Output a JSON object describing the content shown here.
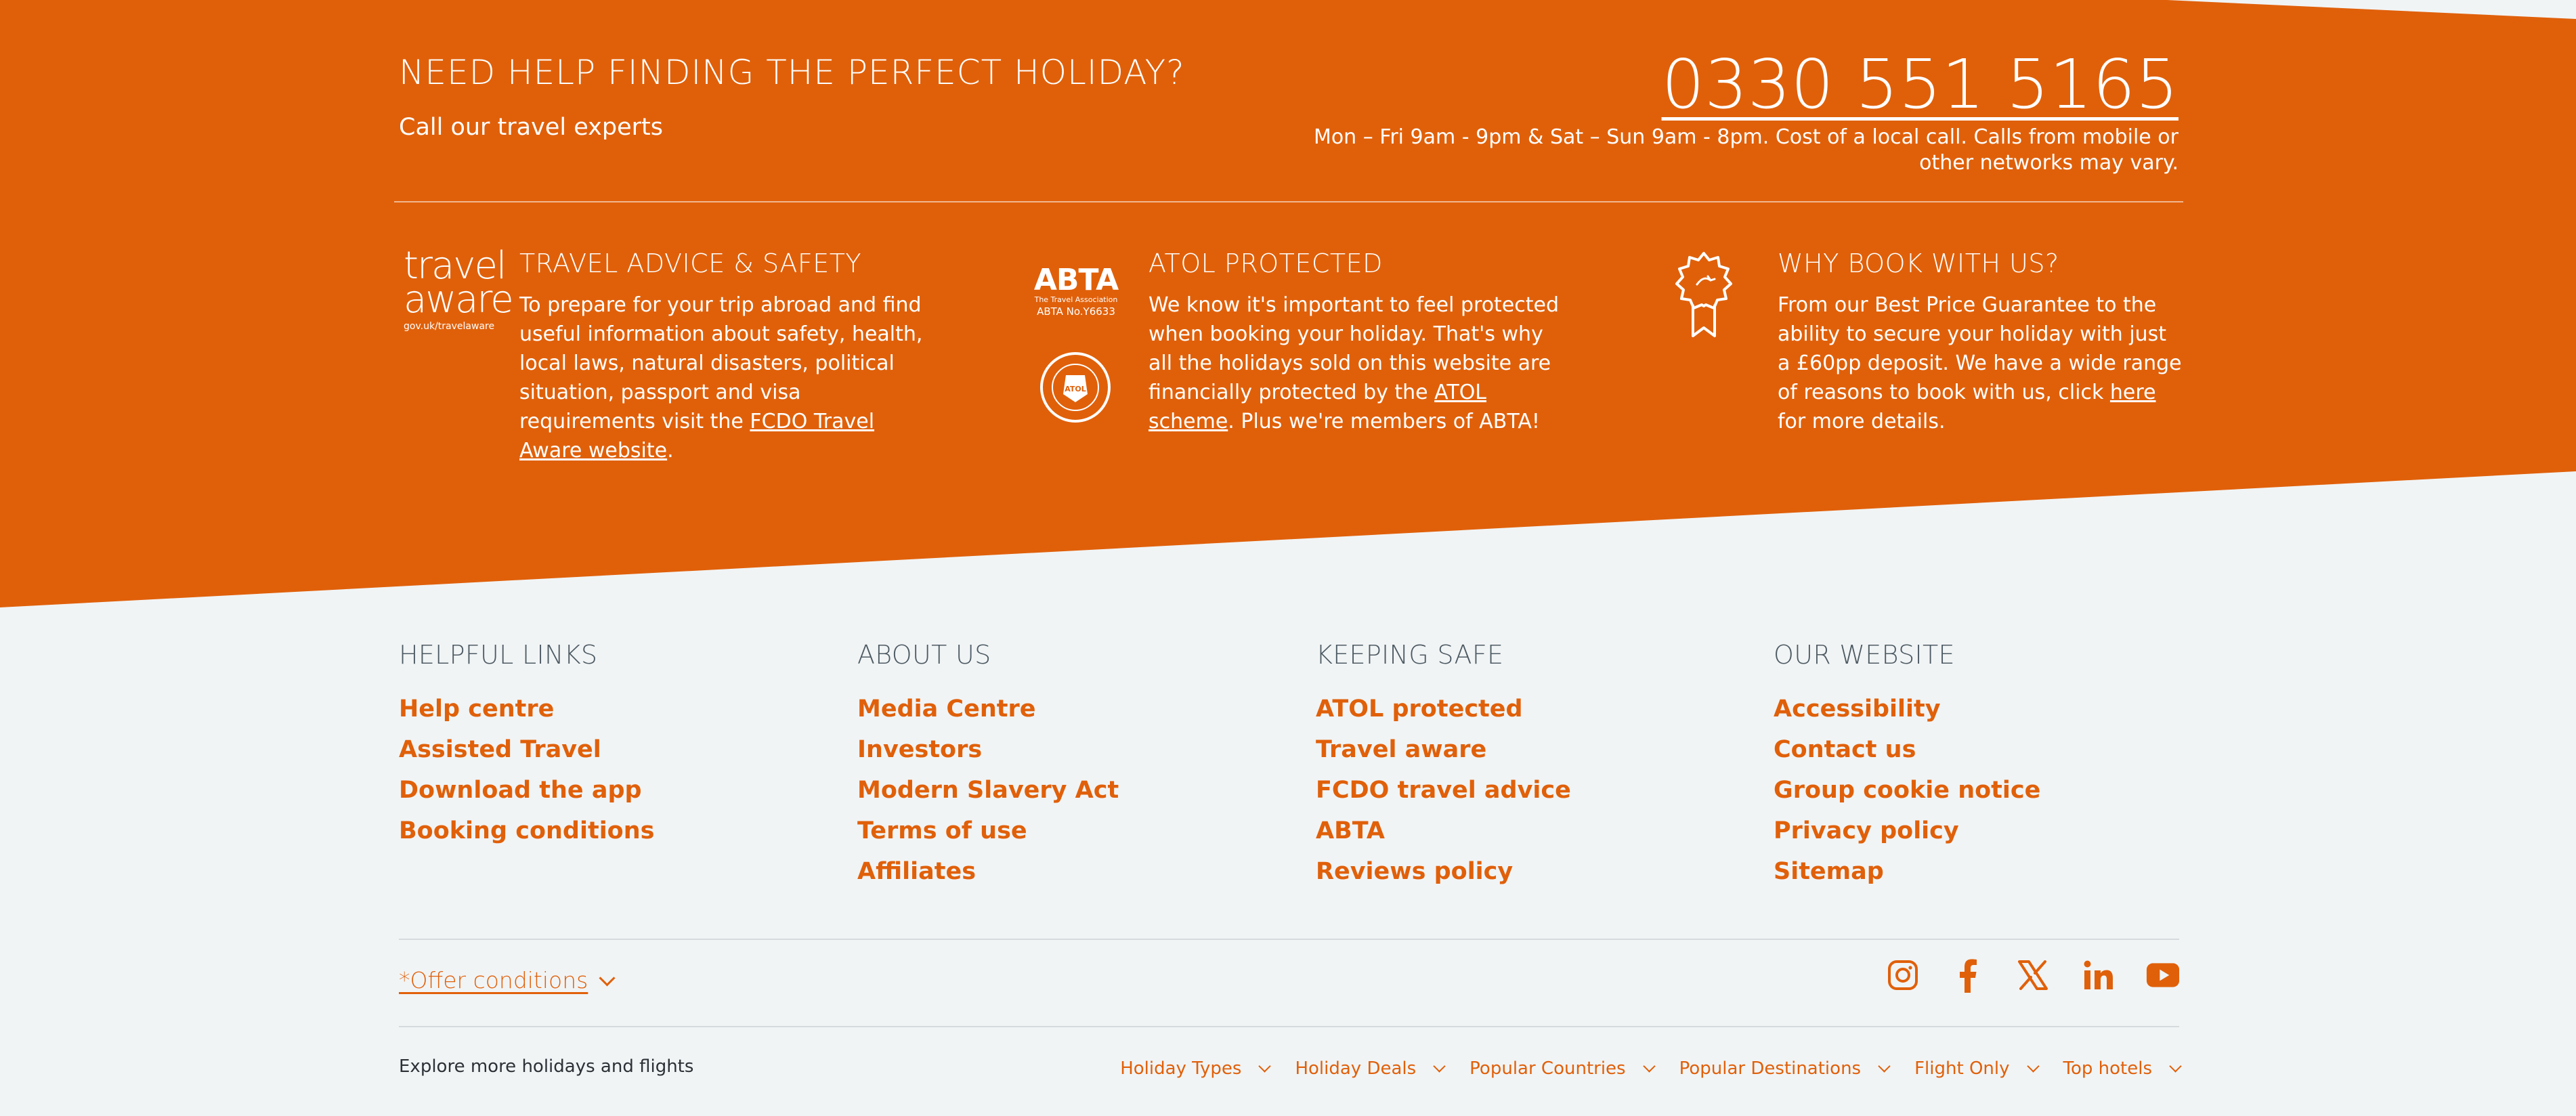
{
  "colors": {
    "brand_orange": "#e0600a",
    "background": "#f1f4f5",
    "heading_grey": "#4d5a63"
  },
  "help": {
    "title": "NEED HELP FINDING THE PERFECT HOLIDAY?",
    "subtitle": "Call our travel experts",
    "phone": "0330 551 5165",
    "hours": "Mon – Fri 9am - 9pm & Sat – Sun 9am - 8pm. Cost of a local call. Calls from mobile or other networks may vary."
  },
  "features": {
    "travel_advice": {
      "logo_word1": "travel",
      "logo_word2": "aware",
      "logo_url": "gov.uk/travelaware",
      "title": "TRAVEL ADVICE & SAFETY",
      "body_before": "To prepare for your trip abroad and find useful information about safety, health, local laws, natural disasters, political situation, passport and visa requirements visit the ",
      "link": "FCDO Travel Aware website",
      "body_after": "."
    },
    "atol": {
      "abta_logo": "ABTA",
      "abta_small": "The Travel Association",
      "abta_number": "ABTA No.Y6633",
      "title": "ATOL PROTECTED",
      "body_before": "We know it's important to feel protected when booking your holiday. That's why all the holidays sold on this website are financially protected by the ",
      "link": "ATOL scheme",
      "body_after": ". Plus we're members of ABTA!"
    },
    "why_book": {
      "title": "WHY BOOK WITH US?",
      "body_before": "From our Best Price Guarantee to the ability to secure your holiday with just a £60pp deposit. We have a wide range of reasons to book with us, click ",
      "link": "here ",
      "body_after": "for more details."
    }
  },
  "columns": [
    {
      "heading": "HELPFUL LINKS",
      "links": [
        "Help centre",
        "Assisted Travel",
        "Download the app",
        "Booking conditions"
      ]
    },
    {
      "heading": "ABOUT US",
      "links": [
        "Media Centre",
        "Investors",
        "Modern Slavery Act",
        "Terms of use",
        "Affiliates"
      ]
    },
    {
      "heading": "KEEPING SAFE",
      "links": [
        "ATOL protected",
        "Travel aware",
        "FCDO travel advice",
        "ABTA",
        "Reviews policy"
      ]
    },
    {
      "heading": "OUR WEBSITE",
      "links": [
        "Accessibility",
        "Contact us",
        "Group cookie notice",
        "Privacy policy",
        "Sitemap"
      ]
    }
  ],
  "offer_conditions": "*Offer conditions",
  "socials": [
    "instagram-icon",
    "facebook-icon",
    "x-icon",
    "linkedin-icon",
    "youtube-icon"
  ],
  "explore": "Explore more holidays and flights",
  "explore_menus": [
    "Holiday Types",
    "Holiday Deals",
    "Popular Countries",
    "Popular Destinations",
    "Flight Only",
    "Top hotels"
  ]
}
